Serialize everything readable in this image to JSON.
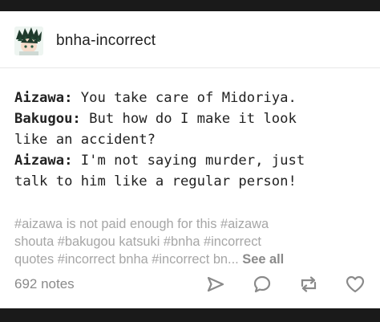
{
  "post": {
    "blog_name": "bnha-incorrect",
    "dialog": [
      {
        "speaker": "Aizawa:",
        "lines": [
          " You take care of Midoriya."
        ]
      },
      {
        "speaker": "Bakugou:",
        "lines": [
          " But how do I make it look",
          "like an accident?"
        ]
      },
      {
        "speaker": "Aizawa:",
        "lines": [
          " I'm not saying murder, just",
          "talk to him like a regular person!"
        ]
      }
    ],
    "tags": [
      "#aizawa is not paid enough for this  #aizawa",
      "shouta  #bakugou katsuki  #bnha  #incorrect",
      "quotes  #incorrect bnha  #incorrect bn..."
    ],
    "see_all": "See all",
    "notes": "692 notes",
    "icons": {
      "share": "share-arrow-icon",
      "reply": "reply-bubble-icon",
      "reblog": "reblog-icon",
      "like": "heart-icon"
    }
  }
}
